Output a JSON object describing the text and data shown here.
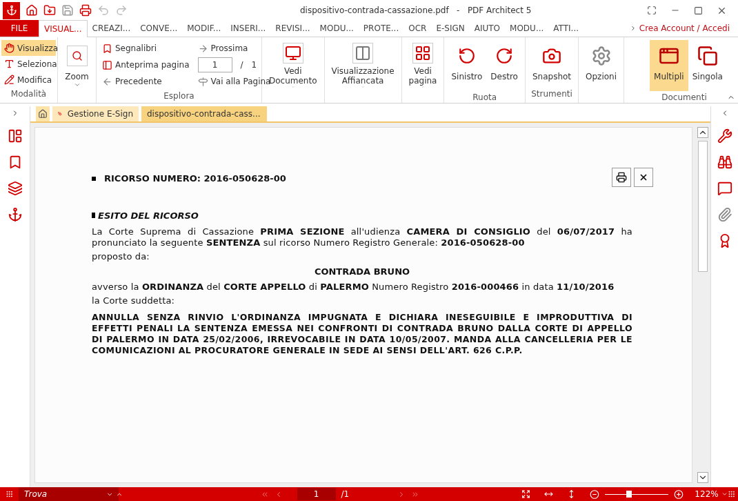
{
  "window": {
    "title": "dispositivo-contrada-cassazione.pdf   -   PDF Architect 5"
  },
  "menu_tabs": [
    {
      "label": "FILE",
      "kind": "file",
      "selected": false
    },
    {
      "label": "VISUAL...",
      "kind": "tab",
      "selected": true
    },
    {
      "label": "CREAZI...",
      "kind": "tab",
      "selected": false
    },
    {
      "label": "CONVE...",
      "kind": "tab",
      "selected": false
    },
    {
      "label": "MODIF...",
      "kind": "tab",
      "selected": false
    },
    {
      "label": "INSERI...",
      "kind": "tab",
      "selected": false
    },
    {
      "label": "REVISI...",
      "kind": "tab",
      "selected": false
    },
    {
      "label": "MODU...",
      "kind": "tab",
      "selected": false
    },
    {
      "label": "PROTE...",
      "kind": "tab",
      "selected": false
    },
    {
      "label": "OCR",
      "kind": "tab",
      "selected": false
    },
    {
      "label": "E-SIGN",
      "kind": "tab",
      "selected": false
    },
    {
      "label": "AIUTO",
      "kind": "tab",
      "selected": false
    },
    {
      "label": "MODU...",
      "kind": "tab",
      "selected": false
    },
    {
      "label": "ATTI...",
      "kind": "tab",
      "selected": false
    }
  ],
  "account_link": "Crea Account / Accedi",
  "ribbon": {
    "modes": {
      "label": "Modalità",
      "items": [
        {
          "label": "Visualizza",
          "selected": true
        },
        {
          "label": "Seleziona",
          "selected": false
        },
        {
          "label": "Modifica",
          "selected": false
        }
      ]
    },
    "zoom": {
      "label": "Zoom"
    },
    "explore": {
      "label": "Esplora",
      "left": [
        "Segnalibri",
        "Anteprima pagina",
        "Precedente"
      ],
      "next": "Prossima",
      "page_value": "1",
      "page_sep": "/",
      "page_total": "1",
      "goto": "Vai alla Pagina"
    },
    "views": [
      "Vedi Documento",
      "Visualizzazione Affiancata",
      "Vedi pagina"
    ],
    "rotate": {
      "label": "Ruota",
      "items": [
        "Sinistro",
        "Destro"
      ]
    },
    "tools": {
      "label": "Strumenti",
      "items": [
        "Snapshot"
      ]
    },
    "options": "Opzioni",
    "documents": {
      "label": "Documenti",
      "items": [
        {
          "label": "Multipli",
          "selected": true
        },
        {
          "label": "Singola",
          "selected": false
        }
      ]
    }
  },
  "doc_tabs": [
    {
      "label": "Gestione E-Sign",
      "selected": false
    },
    {
      "label": "dispositivo-contrada-cass...",
      "selected": true
    }
  ],
  "document": {
    "heading": "RICORSO NUMERO: 2016-050628-00",
    "section": "ESITO DEL RICORSO",
    "paragraphs": [
      {
        "kind": "text",
        "text": "La Corte Suprema di Cassazione **PRIMA SEZIONE** all'udienza **CAMERA DI CONSIGLIO** del **06/07/2017** ha pronunciato la seguente **SENTENZA** sul ricorso Numero Registro Generale: **2016-050628-00**"
      },
      {
        "kind": "text",
        "text": "proposto da:"
      },
      {
        "kind": "center",
        "text": "CONTRADA BRUNO"
      },
      {
        "kind": "text",
        "text": "avverso la **ORDINANZA** del **CORTE APPELLO** di **PALERMO** Numero Registro **2016-000466** in data **11/10/2016**"
      },
      {
        "kind": "text",
        "text": "la Corte suddetta:"
      },
      {
        "kind": "bold",
        "text": "ANNULLA SENZA RINVIO L'ORDINANZA IMPUGNATA E DICHIARA INESEGUIBILE E IMPRODUTTIVA DI EFFETTI PENALI LA SENTENZA EMESSA NEI CONFRONTI DI CONTRADA BRUNO DALLA CORTE DI APPELLO DI PALERMO IN DATA 25/02/2006, IRREVOCABILE IN DATA 10/05/2007. MANDA ALLA CANCELLERIA PER LE COMUNICAZIONI AL PROCURATORE GENERALE IN SEDE AI SENSI DELL'ART. 626 C.P.P."
      }
    ]
  },
  "status_bar": {
    "search_placeholder": "Trova",
    "page": "1",
    "total": "/1",
    "zoom": "122%",
    "zoom_slider": {
      "level": 0.38
    }
  }
}
